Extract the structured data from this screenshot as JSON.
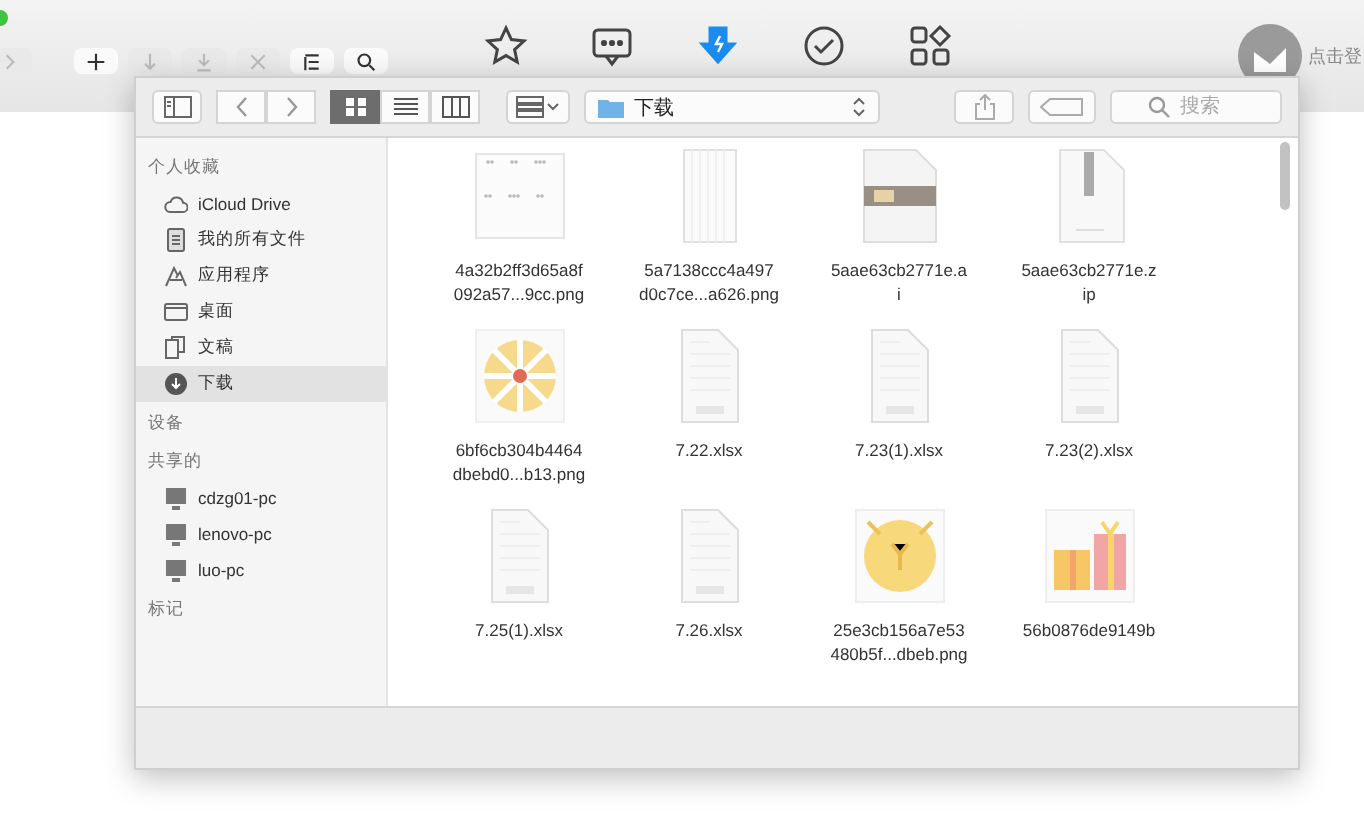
{
  "background_app": {
    "left_buttons": [
      {
        "kind": "forward",
        "disabled": true
      },
      {
        "kind": "plus",
        "disabled": false
      },
      {
        "kind": "down",
        "disabled": true
      },
      {
        "kind": "download",
        "disabled": true
      },
      {
        "kind": "close",
        "disabled": true
      },
      {
        "kind": "list",
        "disabled": false
      },
      {
        "kind": "search",
        "disabled": false
      }
    ],
    "nav_tabs": [
      {
        "kind": "star",
        "selected": false
      },
      {
        "kind": "chat",
        "selected": false
      },
      {
        "kind": "download",
        "selected": true
      },
      {
        "kind": "check",
        "selected": false
      },
      {
        "kind": "apps",
        "selected": false
      }
    ],
    "login_text": "点击登"
  },
  "finder": {
    "toolbar": {
      "views": [
        {
          "kind": "icons",
          "selected": true
        },
        {
          "kind": "list",
          "selected": false
        },
        {
          "kind": "columns",
          "selected": false
        }
      ],
      "path": "下载",
      "search": {
        "placeholder": "搜索"
      }
    },
    "sidebar": [
      {
        "title": "个人收藏",
        "items": [
          {
            "label": "iCloud Drive",
            "kind": "cloud",
            "selected": false
          },
          {
            "label": "我的所有文件",
            "kind": "files",
            "selected": false
          },
          {
            "label": "应用程序",
            "kind": "apps",
            "selected": false
          },
          {
            "label": "桌面",
            "kind": "desktop",
            "selected": false
          },
          {
            "label": "文稿",
            "kind": "docs",
            "selected": false
          },
          {
            "label": "下载",
            "kind": "download",
            "selected": true
          }
        ]
      },
      {
        "title": "设备"
      },
      {
        "title": "共享的",
        "items": [
          {
            "label": "cdzg01-pc",
            "kind": "computer",
            "selected": false
          },
          {
            "label": "lenovo-pc",
            "kind": "computer",
            "selected": false
          },
          {
            "label": "luo-pc",
            "kind": "computer",
            "selected": false
          }
        ]
      },
      {
        "title": "标记"
      }
    ],
    "files": [
      {
        "lines": [
          "4a32b2ff3d65a8f",
          "092a57...9cc.png"
        ],
        "kind": "dots"
      },
      {
        "lines": [
          "5a7138ccc4a497",
          "d0c7ce...a626.png"
        ],
        "kind": "blank"
      },
      {
        "lines": [
          "5aae63cb2771e.a",
          "i"
        ],
        "kind": "ai"
      },
      {
        "lines": [
          "5aae63cb2771e.z",
          "ip"
        ],
        "kind": "zip"
      },
      {
        "lines": [
          "6bf6cb304b4464",
          "dbebd0...b13.png"
        ],
        "kind": "wheel"
      },
      {
        "lines": [
          "7.22.xlsx"
        ],
        "kind": "xlsx"
      },
      {
        "lines": [
          "7.23(1).xlsx"
        ],
        "kind": "xlsx"
      },
      {
        "lines": [
          "7.23(2).xlsx"
        ],
        "kind": "xlsx"
      },
      {
        "lines": [
          "7.25(1).xlsx"
        ],
        "kind": "xlsx"
      },
      {
        "lines": [
          "7.26.xlsx"
        ],
        "kind": "xlsx"
      },
      {
        "lines": [
          "25e3cb156a7e53",
          "480b5f...dbeb.png"
        ],
        "kind": "coin"
      },
      {
        "lines": [
          "56b0876de9149b"
        ],
        "kind": "gift"
      }
    ]
  }
}
